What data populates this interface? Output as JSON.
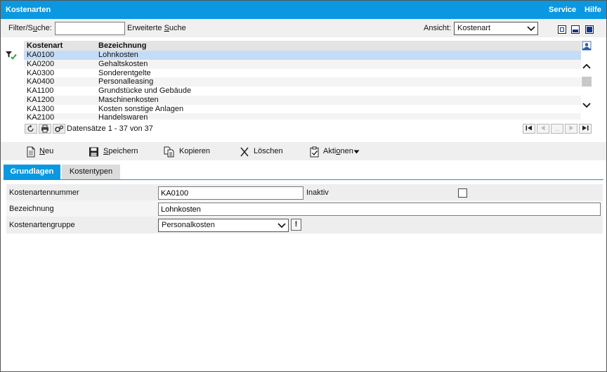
{
  "window": {
    "title": "Kostenarten",
    "service_link": "Service",
    "help_link": "Hilfe"
  },
  "filter": {
    "label_pre": "Filter/S",
    "label_u": "u",
    "label_post": "che:",
    "value": "",
    "advanced_pre": "Erweiterte ",
    "advanced_u": "S",
    "advanced_post": "uche",
    "view_label": "Ansicht:",
    "view_value": "Kostenart"
  },
  "grid": {
    "columns": [
      "Kostenart",
      "Bezeichnung"
    ],
    "rows": [
      [
        "KA0100",
        "Lohnkosten"
      ],
      [
        "KA0200",
        "Gehaltskosten"
      ],
      [
        "KA0300",
        "Sonderentgelte"
      ],
      [
        "KA0400",
        "Personalleasing"
      ],
      [
        "KA1100",
        "Grundstücke und Gebäude"
      ],
      [
        "KA1200",
        "Maschinenkosten"
      ],
      [
        "KA1300",
        "Kosten sonstige Anlagen"
      ],
      [
        "KA2100",
        "Handelswaren"
      ]
    ],
    "selected_index": 0,
    "records_text": "Datensätze 1 - 37 von 37",
    "pager_ellipsis": "..."
  },
  "toolbar": {
    "new_u": "N",
    "new_rest": "eu",
    "save_u": "S",
    "save_rest": "peichern",
    "copy": "Kopieren",
    "delete": "Löschen",
    "actions_pre": "Akti",
    "actions_u": "o",
    "actions_post": "nen"
  },
  "tabs": [
    {
      "label": "Grundlagen",
      "active": true
    },
    {
      "label": "Kostentypen",
      "active": false
    }
  ],
  "form": {
    "number_label": "Kostenartennummer",
    "number_value": "KA0100",
    "inactive_label": "Inaktiv",
    "inactive_checked": false,
    "name_label": "Bezeichnung",
    "name_value": "Lohnkosten",
    "group_label": "Kostenartengruppe",
    "group_value": "Personalkosten",
    "info_button": "!"
  },
  "colors": {
    "accent": "#0a98e0",
    "selected_row": "#c5dcf7"
  }
}
